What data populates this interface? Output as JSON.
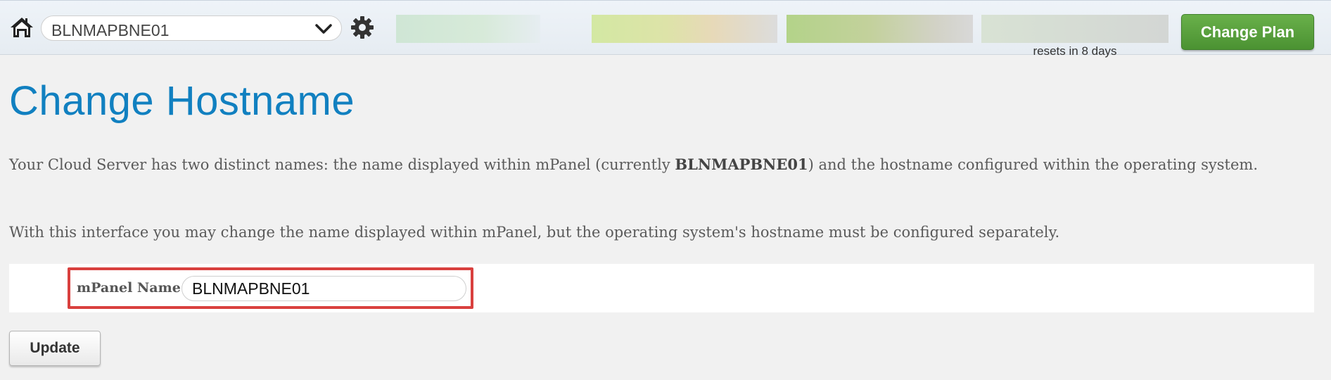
{
  "header": {
    "home_icon": "home-icon",
    "server_select": {
      "selected": "BLNMAPBNE01",
      "icon": "chevron-down-icon"
    },
    "settings_icon": "gear-icon",
    "usage": {
      "resets_label": "resets in 8 days"
    },
    "change_plan_label": "Change Plan",
    "change_plan_color": "#5aa23d"
  },
  "main": {
    "title": "Change Hostname",
    "title_color": "#1180c0",
    "paragraph1": {
      "before": "Your Cloud Server has two distinct names: the name displayed within mPanel (currently ",
      "server_name": "BLNMAPBNE01",
      "after": ") and the hostname configured within the operating system."
    },
    "paragraph2": "With this interface you may change the name displayed within mPanel, but the operating system's hostname must be configured separately.",
    "form": {
      "label": "mPanel Name:",
      "value": "BLNMAPBNE01",
      "highlight_color": "#d9403e"
    },
    "update_label": "Update"
  }
}
